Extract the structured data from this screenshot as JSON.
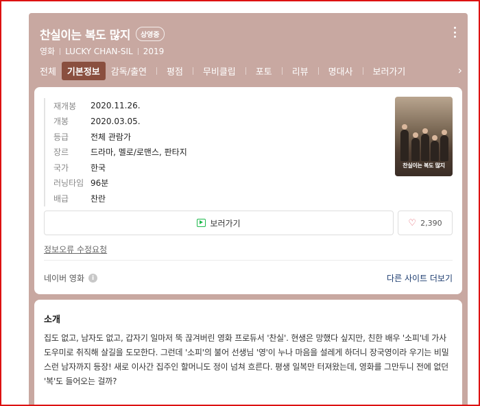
{
  "movie": {
    "title": "찬실이는 복도 많지",
    "status_badge": "상영중",
    "category": "영화",
    "english_title": "LUCKY CHAN-SIL",
    "year": "2019"
  },
  "tabs": [
    {
      "label": "전체"
    },
    {
      "label": "기본정보"
    },
    {
      "label": "감독/출연"
    },
    {
      "label": "평점"
    },
    {
      "label": "무비클립"
    },
    {
      "label": "포토"
    },
    {
      "label": "리뷰"
    },
    {
      "label": "명대사"
    },
    {
      "label": "보러가기"
    }
  ],
  "info": [
    {
      "key": "재개봉",
      "value": "2020.11.26."
    },
    {
      "key": "개봉",
      "value": "2020.03.05."
    },
    {
      "key": "등급",
      "value": "전체 관람가"
    },
    {
      "key": "장르",
      "value": "드라마, 멜로/로맨스, 판타지"
    },
    {
      "key": "국가",
      "value": "한국"
    },
    {
      "key": "러닝타임",
      "value": "96분"
    },
    {
      "key": "배급",
      "value": "찬란"
    }
  ],
  "poster": {
    "text": "찬실이는 복도 많지"
  },
  "actions": {
    "watch_label": "보러가기",
    "like_count": "2,390",
    "report_label": "정보오류 수정요청"
  },
  "source": {
    "label": "네이버 영화",
    "other_sites": "다른 사이트 더보기"
  },
  "intro": {
    "title": "소개",
    "text": "집도 없고, 남자도 없고, 갑자기 일마저 뚝 끊겨버린 영화 프로듀서 '찬실'. 현생은 망했다 싶지만, 친한 배우 '소피'네 가사도우미로 취직해 살길을 도모한다. 그런데 '소피'의 불어 선생님 '영'이 누나 마음을 설레게 하더니 장국영이라 우기는 비밀스런 남자까지 등장! 새로 이사간 집주인 할머니도 정이 넘쳐 흐른다. 평생 일복만 터져왔는데, 영화를 그만두니 전에 없던 '복'도 들어오는 걸까?"
  }
}
